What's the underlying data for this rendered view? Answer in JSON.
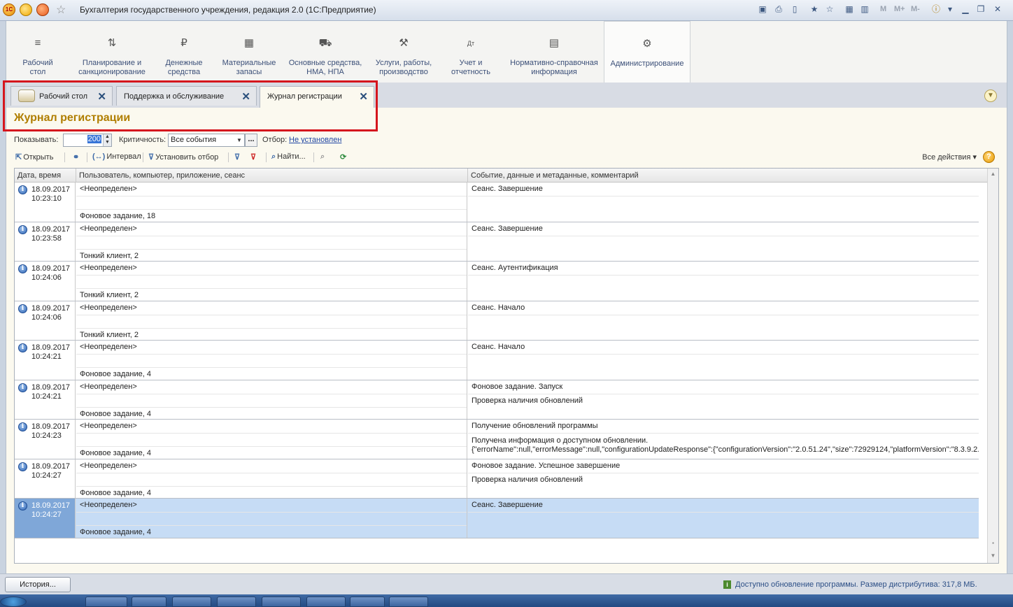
{
  "window": {
    "title": "Бухгалтерия государственного учреждения, редакция 2.0  (1С:Предприятие)",
    "app_icon": "1C",
    "toolbar_text": [
      "M",
      "M+",
      "M-"
    ]
  },
  "sections": [
    {
      "icon": "menu-icon",
      "glyph": "≡",
      "label": "Рабочий\nстол"
    },
    {
      "icon": "planning-icon",
      "glyph": "⇅",
      "label": "Планирование и\nсанкционирование"
    },
    {
      "icon": "money-icon",
      "glyph": "₽",
      "label": "Денежные\nсредства"
    },
    {
      "icon": "inventory-icon",
      "glyph": "▦",
      "label": "Материальные\nзапасы"
    },
    {
      "icon": "truck-icon",
      "glyph": "⛟",
      "label": "Основные средства,\nНМА, НПА"
    },
    {
      "icon": "tools-icon",
      "glyph": "⚒",
      "label": "Услуги, работы,\nпроизводство"
    },
    {
      "icon": "accounting-icon",
      "glyph": "Дт",
      "label": "Учет и\nотчетность"
    },
    {
      "icon": "reference-icon",
      "glyph": "▤",
      "label": "Нормативно-справочная\nинформация"
    },
    {
      "icon": "gear-icon",
      "glyph": "⚙",
      "label": "Администрирование"
    }
  ],
  "tabs": [
    {
      "label": "Рабочий стол",
      "close": "✕"
    },
    {
      "label": "Поддержка и обслуживание",
      "close": "✕"
    },
    {
      "label": "Журнал регистрации",
      "close": "✕"
    }
  ],
  "form": {
    "title": "Журнал регистрации",
    "filters": {
      "show_label": "Показывать:",
      "show_value": "200",
      "criticality_label": "Критичность:",
      "criticality_value": "Все события",
      "filter_label": "Отбор:",
      "filter_value": "Не установлен"
    },
    "commands": {
      "open": "Открыть",
      "interval": "Интервал",
      "set_filter": "Установить отбор",
      "find": "Найти...",
      "all_actions": "Все действия",
      "help": "?"
    },
    "table": {
      "columns": [
        "Дата, время",
        "Пользователь, компьютер, приложение, сеанс",
        "Событие, данные и метаданные, комментарий"
      ],
      "rows": [
        {
          "date": "18.09.2017",
          "time": "10:23:10",
          "user": "<Неопределен>",
          "user_l2": "",
          "app": "Фоновое задание, 18",
          "event": "Сеанс. Завершение",
          "event_l2": "",
          "event_l3": ""
        },
        {
          "date": "18.09.2017",
          "time": "10:23:58",
          "user": "<Неопределен>",
          "user_l2": "",
          "app": "Тонкий клиент, 2",
          "event": "Сеанс. Завершение",
          "event_l2": "",
          "event_l3": ""
        },
        {
          "date": "18.09.2017",
          "time": "10:24:06",
          "user": "<Неопределен>",
          "user_l2": "",
          "app": "Тонкий клиент, 2",
          "event": "Сеанс. Аутентификация",
          "event_l2": "",
          "event_l3": ""
        },
        {
          "date": "18.09.2017",
          "time": "10:24:06",
          "user": "<Неопределен>",
          "user_l2": "",
          "app": "Тонкий клиент, 2",
          "event": "Сеанс. Начало",
          "event_l2": "",
          "event_l3": ""
        },
        {
          "date": "18.09.2017",
          "time": "10:24:21",
          "user": "<Неопределен>",
          "user_l2": "",
          "app": "Фоновое задание, 4",
          "event": "Сеанс. Начало",
          "event_l2": "",
          "event_l3": ""
        },
        {
          "date": "18.09.2017",
          "time": "10:24:21",
          "user": "<Неопределен>",
          "user_l2": "",
          "app": "Фоновое задание, 4",
          "event": "Фоновое задание. Запуск",
          "event_l2": "Проверка наличия обновлений",
          "event_l3": ""
        },
        {
          "date": "18.09.2017",
          "time": "10:24:23",
          "user": "<Неопределен>",
          "user_l2": "",
          "app": "Фоновое задание, 4",
          "event": "Получение обновлений программы",
          "event_l2": "Получена информация о доступном обновлении.",
          "event_l3": "{\"errorName\":null,\"errorMessage\":null,\"configurationUpdateResponse\":{\"configurationVersion\":\"2.0.51.24\",\"size\":72929124,\"platformVersion\":\"8.3.9.2..."
        },
        {
          "date": "18.09.2017",
          "time": "10:24:27",
          "user": "<Неопределен>",
          "user_l2": "",
          "app": "Фоновое задание, 4",
          "event": "Фоновое задание. Успешное завершение",
          "event_l2": "Проверка наличия обновлений",
          "event_l3": ""
        },
        {
          "date": "18.09.2017",
          "time": "10:24:27",
          "user": "<Неопределен>",
          "user_l2": "",
          "app": "Фоновое задание, 4",
          "event": "Сеанс. Завершение",
          "event_l2": "",
          "event_l3": "",
          "selected": true
        }
      ]
    }
  },
  "status": {
    "history_button": "История...",
    "update_message": "Доступно обновление программы. Размер дистрибутива: 317,8 МБ."
  },
  "colors": {
    "form_title": "#b07e00",
    "highlight_box": "#d5161d",
    "selected_row": "#c6dcf5",
    "link": "#2147a3"
  }
}
